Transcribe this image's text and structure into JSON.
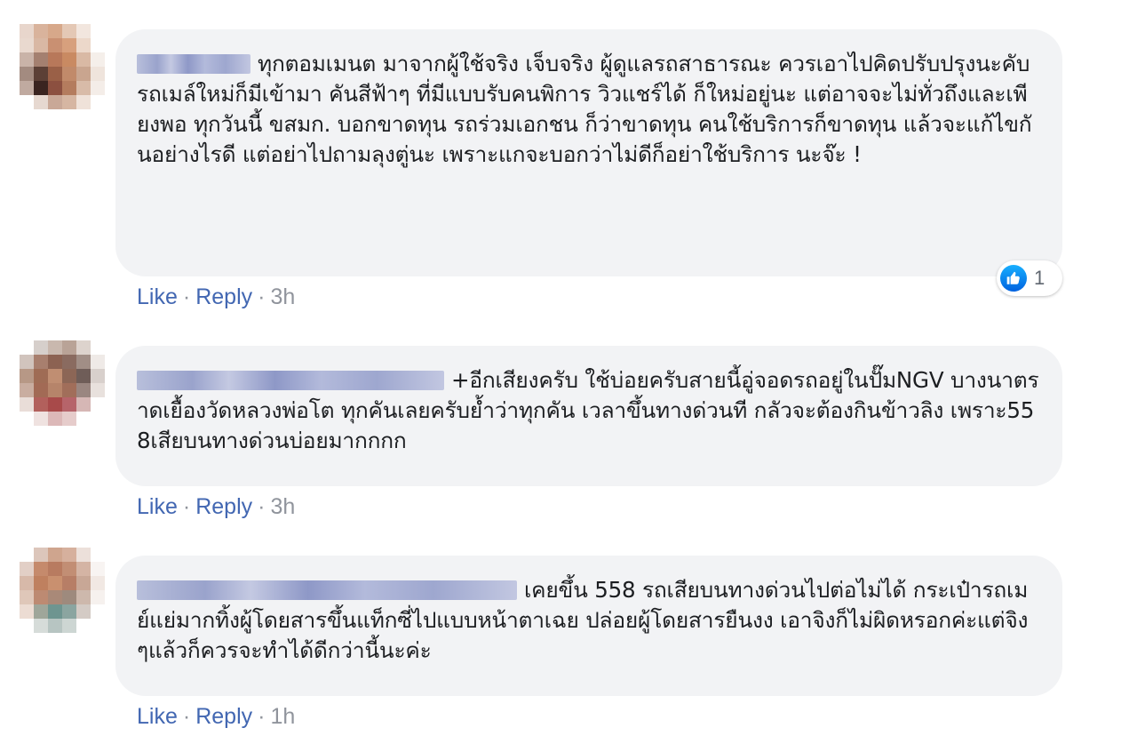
{
  "comments": [
    {
      "text": "ทุกตอมเมนต มาจากผู้ใช้จริง เจ็บจริง ผู้ดูแลรถสาธารณะ ควรเอาไปคิดปรับปรุงนะคับ รถเมล์ใหม่ก็มีเข้ามา คันสีฟ้าๆ ที่มีแบบรับคนพิการ วิวแชร์ได้ ก็ใหม่อยู่นะ แต่อาจจะไม่ทั่วถึงและเพียงพอ ทุกวันนี้ ขสมก. บอกขาดทุน รถร่วมเอกชน ก็ว่าขาดทุน คนใช้บริการก็ขาดทุน แล้วจะแก้ไขกันอย่างไรดี แต่อย่าไปถามลุงตู่นะ เพราะแกจะบอกว่าไม่ดีก็อย่าใช้บริการ นะจ๊ะ !",
      "like_label": "Like",
      "reply_label": "Reply",
      "separator": "·",
      "time": "3h",
      "reaction_count": "1"
    },
    {
      "text": "+อีกเสียงครับ ใช้บ่อยครับสายนี้อู่จอดรถอยู่ในปั๊มNGV บางนาตราดเยื้องวัดหลวงพ่อโต ทุกคันเลยครับย้ำว่าทุกคัน เวลาขึ้นทางด่วนที กลัวจะต้องกินข้าวลิง เพราะ558เสียบนทางด่วนบ่อยมากกกก",
      "like_label": "Like",
      "reply_label": "Reply",
      "separator": "·",
      "time": "3h"
    },
    {
      "text": "เคยขึ้น 558 รถเสียบนทางด่วนไปต่อไม่ได้ กระเป๋ารถเมย์แย่มากทิ้งผู้โดยสารขึ้นแท็กซี่ไปแบบหน้าตาเฉย ปล่อยผู้โดยสารยืนงง เอาจิงก็ไม่ผิดหรอกค่ะแต่จิงๆแล้วก็ควรจะทำได้ดีกว่านี้นะค่ะ",
      "like_label": "Like",
      "reply_label": "Reply",
      "separator": "·",
      "time": "1h"
    }
  ],
  "colors": {
    "bubble": "#f2f3f5",
    "link": "#4267b2",
    "meta": "#90949c",
    "like_blue": "#1877f2"
  },
  "icons": {
    "reaction": "thumbs-up-icon"
  }
}
